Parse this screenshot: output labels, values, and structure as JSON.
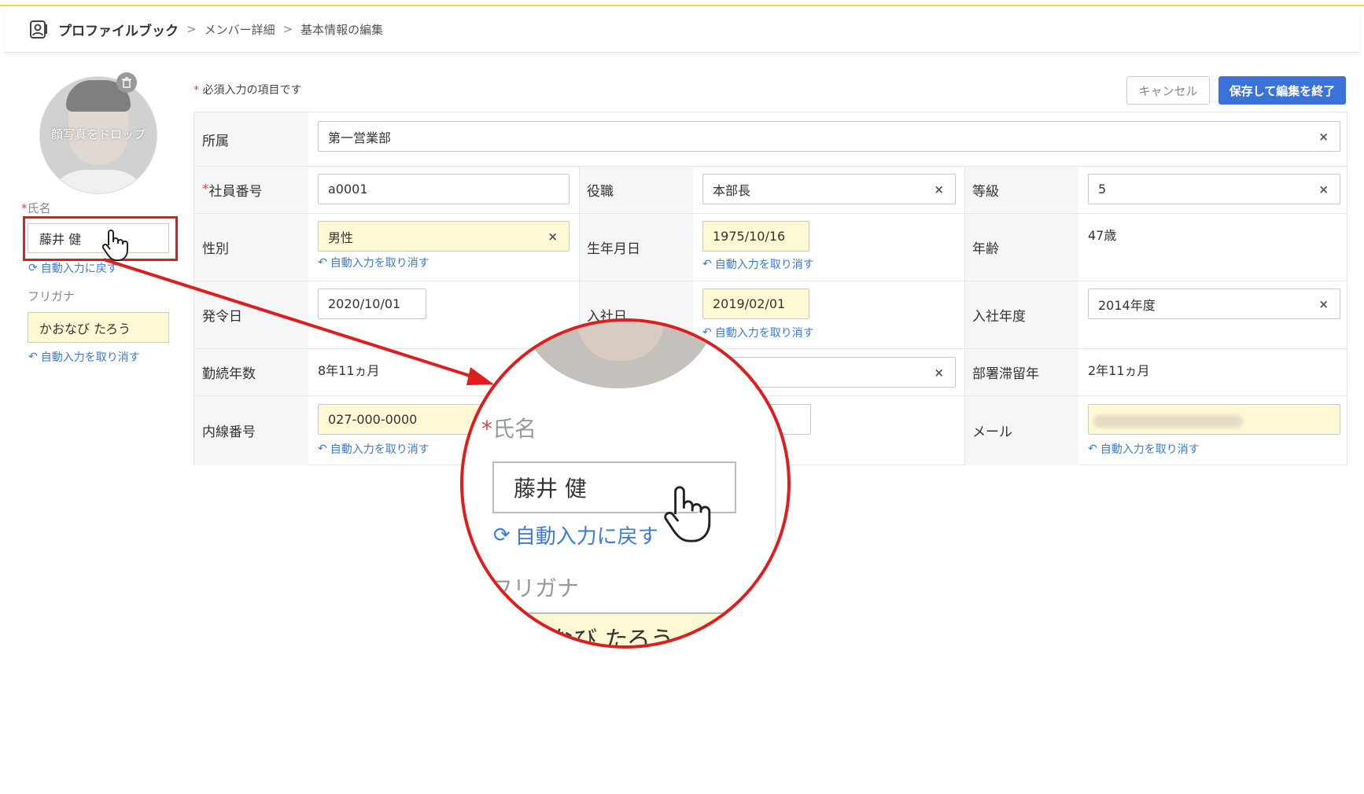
{
  "header": {
    "app_name": "プロファイルブック",
    "breadcrumb_sep": ">",
    "crumb_1": "メンバー詳細",
    "crumb_2": "基本情報の編集"
  },
  "left": {
    "photo_drop": "顔写真をドロップ",
    "name_label_star": "*",
    "name_label": "氏名",
    "name_value": "藤井 健",
    "auto_reset": "自動入力に戻す",
    "kana_label": "フリガナ",
    "kana_value": "かおなび たろう",
    "undo_auto": "自動入力を取り消す"
  },
  "actions": {
    "required_star": "*",
    "required_note": "必須入力の項目です",
    "cancel": "キャンセル",
    "save": "保存して編集を終了"
  },
  "form": {
    "affiliation": {
      "label": "所属",
      "value": "第一営業部"
    },
    "employee_no": {
      "label": "社員番号",
      "value": "a0001"
    },
    "position": {
      "label": "役職",
      "value": "本部長"
    },
    "grade": {
      "label": "等級",
      "value": "5"
    },
    "gender": {
      "label": "性別",
      "value": "男性"
    },
    "birthday": {
      "label": "生年月日",
      "value": "1975/10/16"
    },
    "age": {
      "label": "年齢",
      "value": "47歳"
    },
    "appointment": {
      "label": "発令日",
      "value": "2020/10/01"
    },
    "join_date": {
      "label": "入社日",
      "value": "2019/02/01"
    },
    "join_year": {
      "label": "入社年度",
      "value": "2014年度"
    },
    "tenure": {
      "label": "勤続年数",
      "value": "8年11ヵ月"
    },
    "dept_stay": {
      "label": "部署滞留年",
      "value": "2年11ヵ月"
    },
    "extension": {
      "label": "内線番号",
      "value": "027-000-0000"
    },
    "mail": {
      "label": "メール"
    },
    "undo_auto": "自動入力を取り消す",
    "clear": "×"
  },
  "zoom": {
    "label_star": "*",
    "label": "氏名",
    "name_value": "藤井 健",
    "auto_reset": "自動入力に戻す",
    "kana_label": "フリガナ",
    "kana_partial": "なび たろう"
  },
  "colors": {
    "accent": "#3a72d9",
    "highlight": "#e01c1c",
    "autofill": "#fff8d5",
    "link": "#3b7bd8"
  }
}
